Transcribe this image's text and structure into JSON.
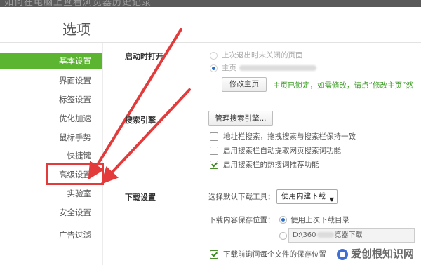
{
  "top_banner": {
    "text": "如何在电脑上查看浏览器历史记录"
  },
  "page_title": "选项",
  "sidebar": {
    "items": [
      {
        "label": "基本设置",
        "active": true
      },
      {
        "label": "界面设置",
        "active": false
      },
      {
        "label": "标签设置",
        "active": false
      },
      {
        "label": "优化加速",
        "active": false
      },
      {
        "label": "鼠标手势",
        "active": false
      },
      {
        "label": "快捷键",
        "active": false
      },
      {
        "label": "高级设置",
        "active": false
      },
      {
        "label": "实验室",
        "active": false
      },
      {
        "label": "安全设置",
        "active": false
      },
      {
        "label": "广告过滤",
        "active": false
      }
    ]
  },
  "startup": {
    "label": "启动时打开",
    "option_last": "上次退出时未关闭的页面",
    "option_home": "主页",
    "modify_home_button": "修改主页",
    "locked_note": "主页已锁定，如需修改，请点“修改主页”然"
  },
  "search_engine": {
    "label": "搜索引擎",
    "manage_button": "管理搜索引擎...",
    "options": [
      {
        "label": "地址栏搜索，拖拽搜索与搜索栏保持一致",
        "checked": false
      },
      {
        "label": "启用搜索栏自动提取网页搜索词功能",
        "checked": false
      },
      {
        "label": "启用搜索栏的热搜词推荐功能",
        "checked": true
      }
    ]
  },
  "download": {
    "label": "下载设置",
    "tool_label": "选择默认下载工具：",
    "tool_value": "使用内建下载",
    "path_label": "下载内容保存位置：",
    "path_option_last": "使用上次下载目录",
    "path_value_prefix": "D:\\360",
    "path_value_suffix": "览器下载",
    "ask_each_file": "下载前询问每个文件的保存位置"
  },
  "watermark": "爱创根知识网",
  "colors": {
    "active_green": "#5cb531",
    "highlight_red": "#e33b3b",
    "note_green": "#3a9a23"
  },
  "icons": {
    "radio": "radio-icon",
    "checkbox": "checkbox-icon",
    "dropdown": "chevron-down-icon",
    "annotation": "arrow-icon"
  }
}
